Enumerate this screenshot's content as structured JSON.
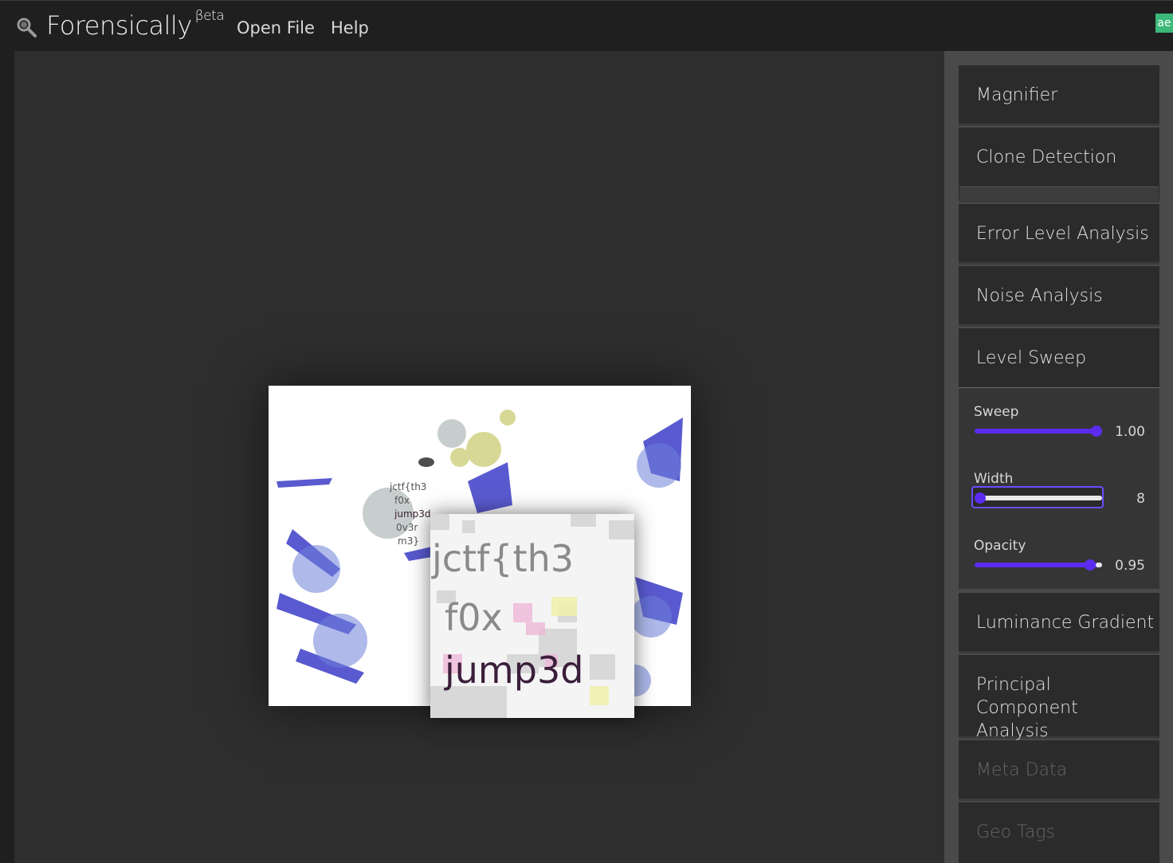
{
  "app": {
    "name": "Forensically",
    "beta_mark": "βeta",
    "corner_badge": "ae"
  },
  "nav": {
    "items": [
      {
        "label": "Open File"
      },
      {
        "label": "Help"
      }
    ]
  },
  "image": {
    "overlay_text": [
      "jctf{th3",
      "f0x",
      "jump3d",
      "0v3r",
      "m3}"
    ],
    "zoom_text": [
      "jctf{th3",
      "f0x",
      "jump3d"
    ]
  },
  "sidebar": {
    "panels": [
      {
        "label": "Magnifier"
      },
      {
        "label": "Clone Detection"
      },
      {
        "label": "Error Level Analysis"
      },
      {
        "label": "Noise Analysis"
      },
      {
        "label": "Level Sweep"
      },
      {
        "label": "Luminance Gradient"
      },
      {
        "label": "Principal Component Analysis"
      },
      {
        "label": "Meta Data",
        "disabled": true
      },
      {
        "label": "Geo Tags",
        "disabled": true
      }
    ],
    "level_sweep": {
      "sweep": {
        "label": "Sweep",
        "value": "1.00",
        "fraction": 1.0
      },
      "width": {
        "label": "Width",
        "value": "8",
        "fraction": 0.0
      },
      "opacity": {
        "label": "Opacity",
        "value": "0.95",
        "fraction": 0.95
      }
    }
  },
  "colors": {
    "accent": "#5b2cf0",
    "background": "#1f1f1f",
    "viewer": "#2e2e2e",
    "sidebar": "#4a4a4a",
    "panel": "#2b2b2b"
  }
}
